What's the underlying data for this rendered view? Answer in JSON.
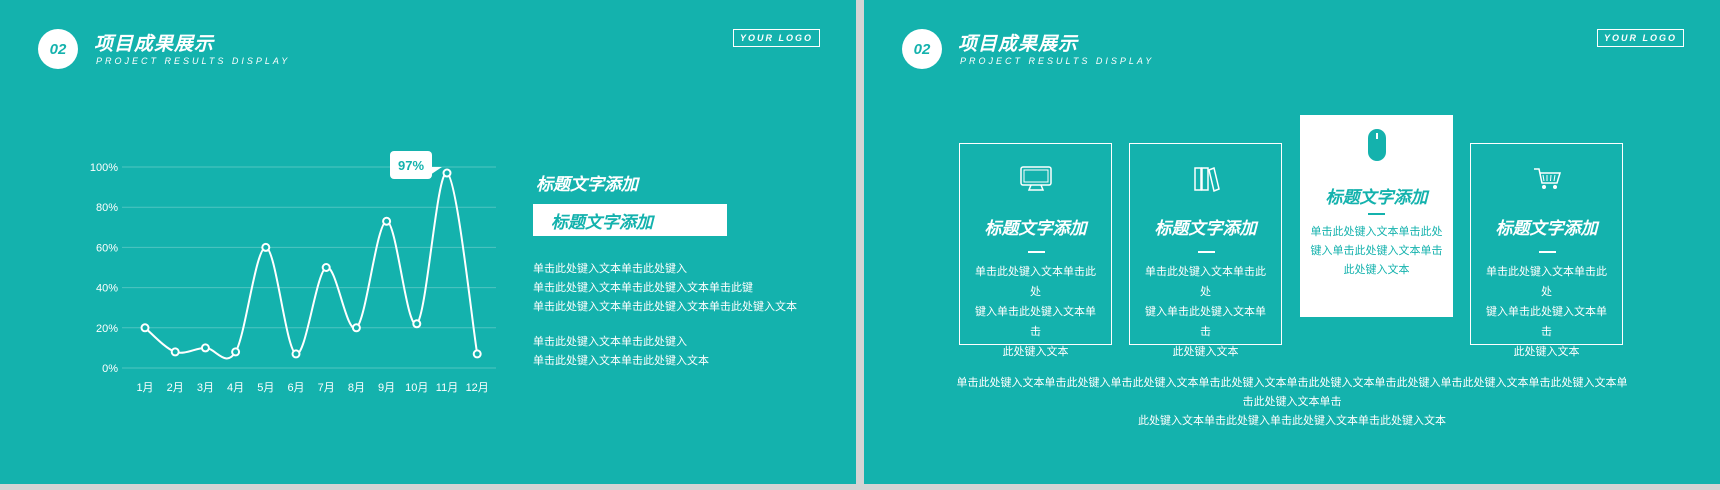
{
  "left": {
    "badge": "02",
    "title": "项目成果展示",
    "subtitle": "PROJECT RESULTS DISPLAY",
    "logo": "YOUR LOGO",
    "heading1": "标题文字添加",
    "heading2": "标题文字添加",
    "paragraph1": [
      "单击此处键入文本单击此处键入",
      "单击此处键入文本单击此处键入文本单击此键",
      "单击此处键入文本单击此处键入文本单击此处键入文本"
    ],
    "paragraph2": [
      "单击此处键入文本单击此处键入",
      "单击此处键入文本单击此处键入文本"
    ],
    "callout": "97%"
  },
  "right": {
    "badge": "02",
    "title": "项目成果展示",
    "subtitle": "PROJECT RESULTS DISPLAY",
    "logo": "YOUR LOGO",
    "cards": [
      {
        "icon": "monitor-icon",
        "title": "标题文字添加",
        "text": [
          "单击此处键入文本单击此处",
          "键入单击此处键入文本单击",
          "此处键入文本"
        ]
      },
      {
        "icon": "books-icon",
        "title": "标题文字添加",
        "text": [
          "单击此处键入文本单击此处",
          "键入单击此处键入文本单击",
          "此处键入文本"
        ]
      },
      {
        "icon": "mouse-icon",
        "title": "标题文字添加",
        "text": [
          "单击此处键入文本单击此处",
          "键入单击此处键入文本单击",
          "此处键入文本"
        ]
      },
      {
        "icon": "shopping-cart-icon",
        "title": "标题文字添加",
        "text": [
          "单击此处键入文本单击此处",
          "键入单击此处键入文本单击",
          "此处键入文本"
        ]
      }
    ],
    "bottom_text": [
      "单击此处键入文本单击此处键入单击此处键入文本单击此处键入文本单击此处键入文本单击此处键入单击此处键入文本单击此处键入文本单击此处键入文本单击",
      "此处键入文本单击此处键入单击此处键入文本单击此处键入文本"
    ]
  },
  "colors": {
    "background": "#14b2ad",
    "foreground": "#ffffff"
  },
  "chart_data": {
    "type": "line",
    "categories": [
      "1月",
      "2月",
      "3月",
      "4月",
      "5月",
      "6月",
      "7月",
      "8月",
      "9月",
      "10月",
      "11月",
      "12月"
    ],
    "series": [
      {
        "values": [
          20,
          8,
          10,
          8,
          60,
          7,
          50,
          20,
          73,
          22,
          97,
          7
        ]
      }
    ],
    "ylim": [
      0,
      100
    ],
    "yticks": [
      "0%",
      "20%",
      "40%",
      "60%",
      "80%",
      "100%"
    ],
    "grid": true,
    "annotation": {
      "category": "11月",
      "label": "97%"
    }
  }
}
